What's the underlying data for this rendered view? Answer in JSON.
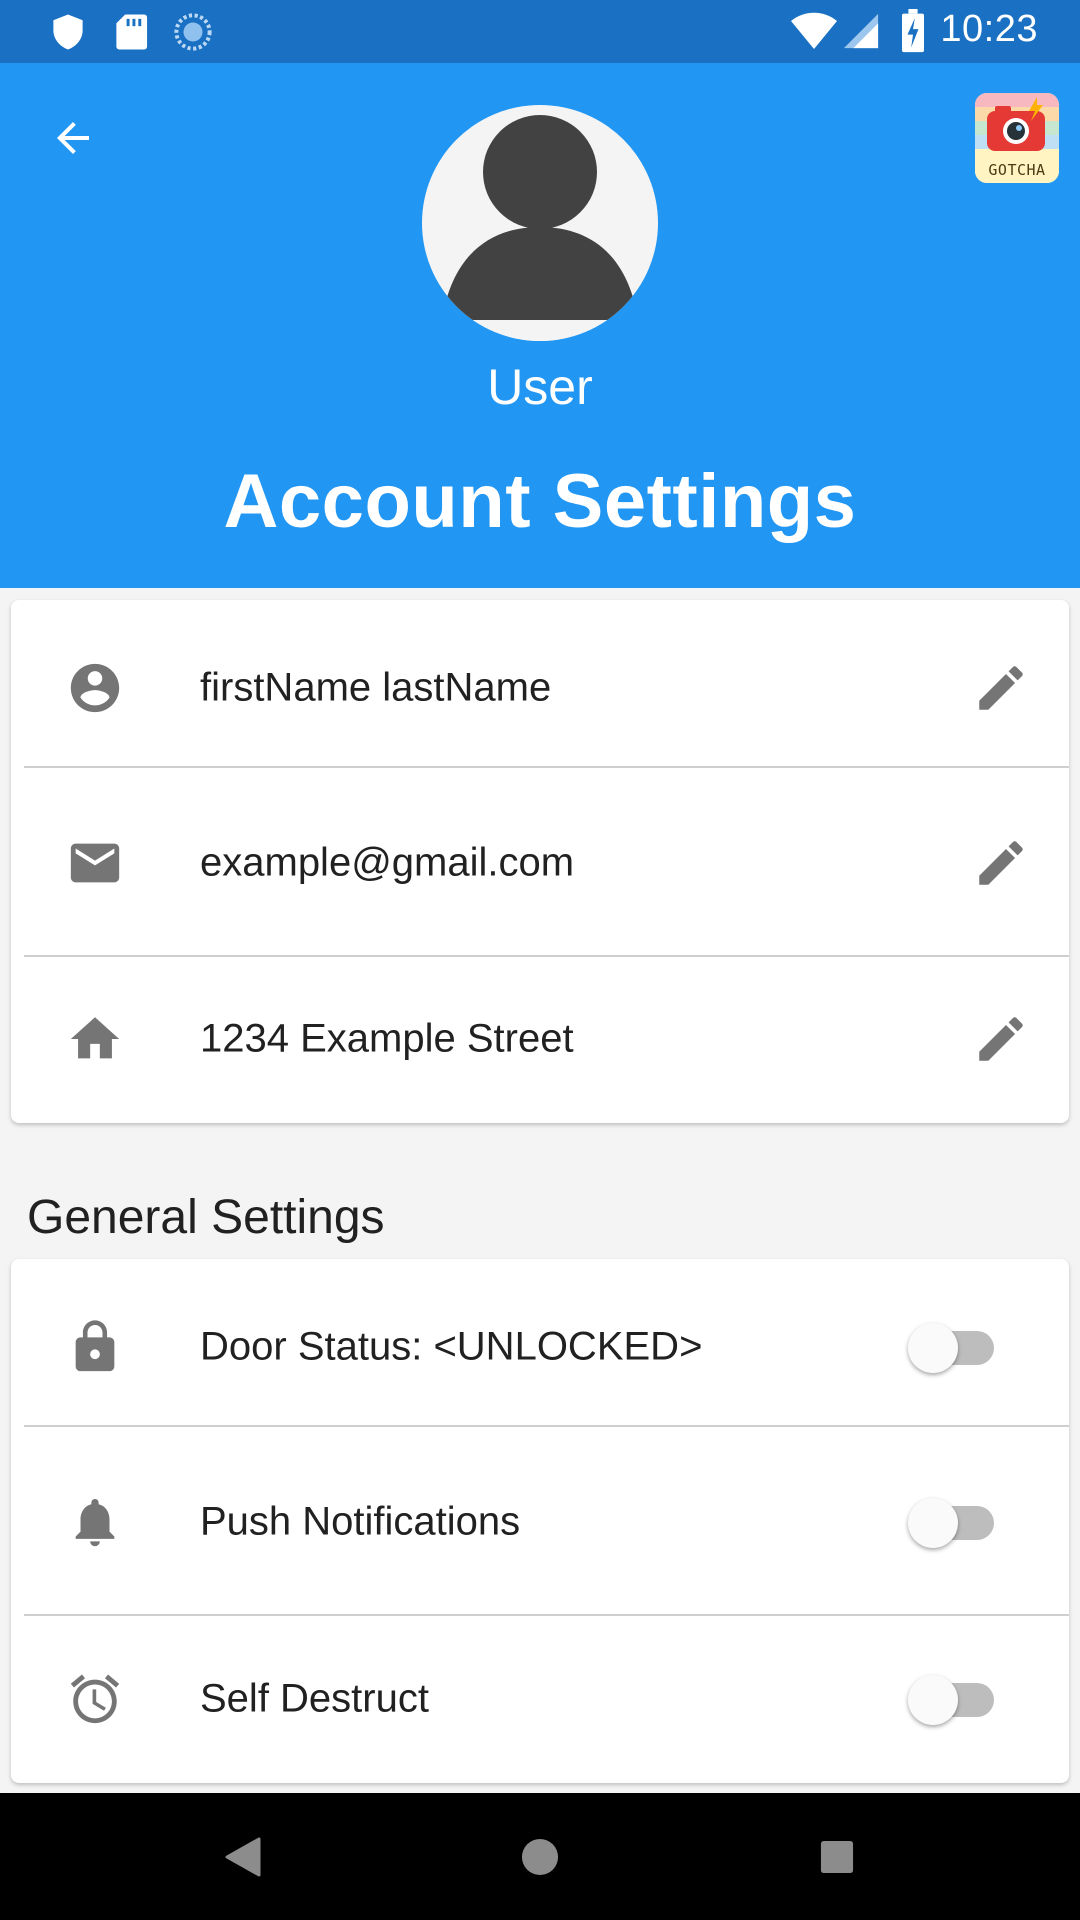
{
  "status_bar": {
    "time": "10:23",
    "icons": [
      "shield-icon",
      "sd-card-icon",
      "sync-icon",
      "wifi-icon",
      "signal-icon",
      "battery-charging-icon"
    ]
  },
  "header": {
    "back_icon": "arrow-back-icon",
    "user_name": "User",
    "title": "Account Settings",
    "gotcha_label": "GOTCHA",
    "colors": {
      "background": "#2196f3",
      "status_bar": "#1a70c2"
    }
  },
  "account": {
    "items": [
      {
        "icon": "account-circle-icon",
        "text": "firstName lastName",
        "action_icon": "edit-pencil-icon"
      },
      {
        "icon": "email-icon",
        "text": "example@gmail.com",
        "action_icon": "edit-pencil-icon"
      },
      {
        "icon": "home-icon",
        "text": "1234 Example Street",
        "action_icon": "edit-pencil-icon"
      }
    ]
  },
  "general": {
    "title": "General Settings",
    "items": [
      {
        "icon": "lock-icon",
        "text": "Door Status: <UNLOCKED>",
        "toggle_on": false
      },
      {
        "icon": "bell-icon",
        "text": "Push Notifications",
        "toggle_on": false
      },
      {
        "icon": "alarm-icon",
        "text": "Self Destruct",
        "toggle_on": false
      }
    ]
  },
  "nav_bar": {
    "buttons": [
      "back-triangle-icon",
      "home-circle-icon",
      "recents-square-icon"
    ]
  }
}
